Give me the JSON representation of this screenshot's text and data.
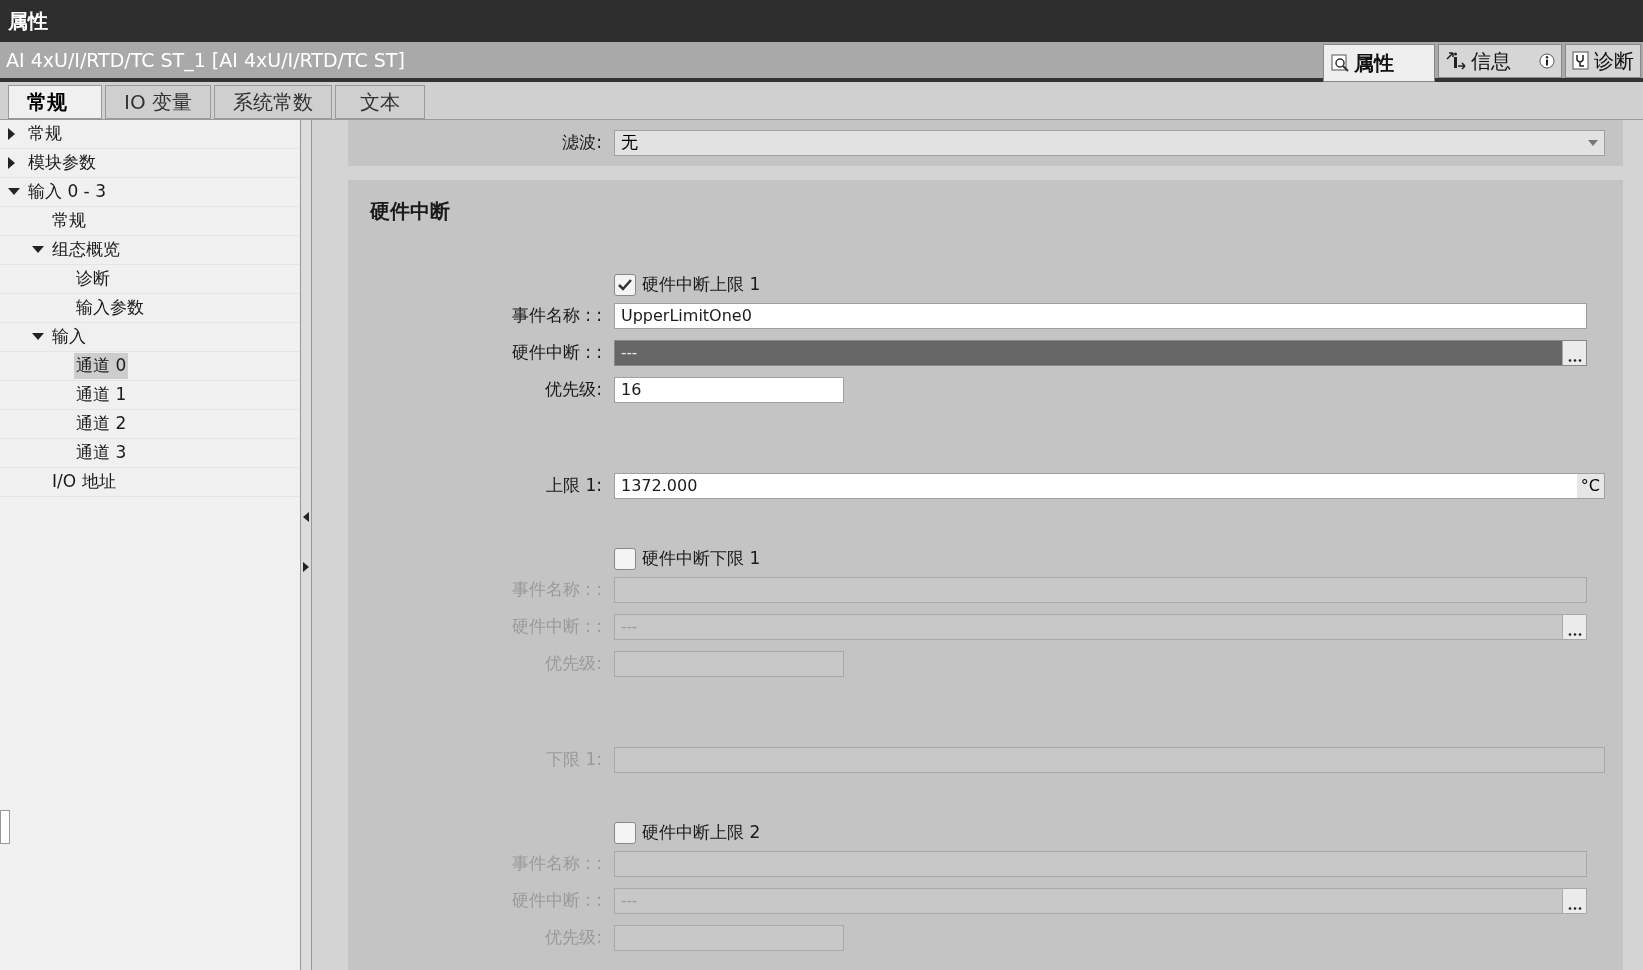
{
  "panel": {
    "title": "属性"
  },
  "header": {
    "object_title": "AI 4xU/I/RTD/TC ST_1 [AI 4xU/I/RTD/TC ST]",
    "tabs": [
      {
        "kind": "properties",
        "label": "属性",
        "selected": true
      },
      {
        "kind": "info",
        "label": "信息",
        "selected": false
      },
      {
        "kind": "diagnostics",
        "label": "诊断",
        "selected": false
      }
    ]
  },
  "tabs": [
    {
      "label": "常规",
      "selected": true
    },
    {
      "label": "IO 变量",
      "selected": false
    },
    {
      "label": "系统常数",
      "selected": false
    },
    {
      "label": "文本",
      "selected": false
    }
  ],
  "tree": [
    {
      "label": "常规",
      "expanded": false,
      "selected": false
    },
    {
      "label": "模块参数",
      "expanded": false,
      "selected": false
    },
    {
      "label": "输入 0 - 3",
      "expanded": true,
      "selected": false,
      "children": [
        {
          "label": "常规",
          "selected": false
        },
        {
          "label": "组态概览",
          "expanded": true,
          "selected": false,
          "children": [
            {
              "label": "诊断",
              "selected": false
            },
            {
              "label": "输入参数",
              "selected": false
            }
          ]
        },
        {
          "label": "输入",
          "expanded": true,
          "selected": false,
          "children": [
            {
              "label": "通道 0",
              "selected": true
            },
            {
              "label": "通道 1",
              "selected": false
            },
            {
              "label": "通道 2",
              "selected": false
            },
            {
              "label": "通道 3",
              "selected": false
            }
          ]
        },
        {
          "label": "I/O 地址",
          "selected": false
        }
      ]
    }
  ],
  "form": {
    "filter": {
      "label": "滤波:",
      "value": "无"
    },
    "section_title": "硬件中断",
    "items": [
      {
        "kind": "interrupt",
        "label": "硬件中断上限 1",
        "checked": true,
        "event_label": "事件名称 : :",
        "event_name": "UpperLimitOne0",
        "hw_label": "硬件中断 : :",
        "hw_value": "---",
        "priority_label": "优先级:",
        "priority": "16"
      },
      {
        "kind": "limit",
        "label": "上限 1:",
        "value": "1372.000",
        "unit": "°C",
        "disabled": false
      },
      {
        "kind": "interrupt",
        "label": "硬件中断下限 1",
        "checked": false,
        "event_label": "事件名称 : :",
        "hw_label": "硬件中断 : :",
        "hw_value": "---",
        "priority_label": "优先级:"
      },
      {
        "kind": "limit",
        "label": "下限 1:",
        "disabled": true
      },
      {
        "kind": "interrupt",
        "label": "硬件中断上限 2",
        "checked": false,
        "event_label": "事件名称 : :",
        "hw_label": "硬件中断 : :",
        "hw_value": "---",
        "priority_label": "优先级:"
      }
    ]
  }
}
